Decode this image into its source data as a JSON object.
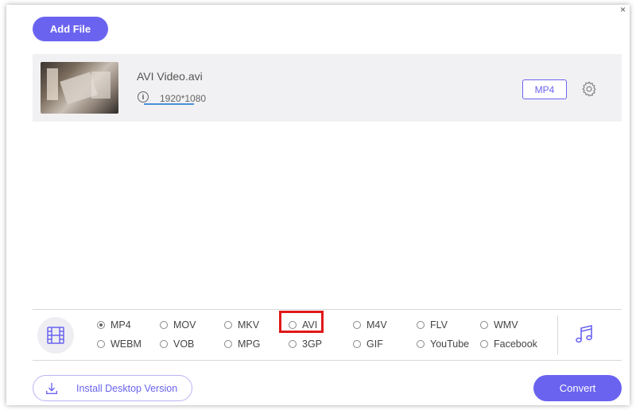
{
  "window": {
    "close_glyph": "×"
  },
  "toolbar": {
    "add_file_label": "Add File"
  },
  "file": {
    "name": "AVI Video.avi",
    "resolution": "1920*1080",
    "info_glyph": "i",
    "output_format": "MP4"
  },
  "formats": {
    "video_category_icon": "film-icon",
    "audio_category_icon": "music-note-icon",
    "row1": [
      "MP4",
      "MOV",
      "MKV",
      "AVI",
      "M4V",
      "FLV",
      "WMV"
    ],
    "row2": [
      "WEBM",
      "VOB",
      "MPG",
      "3GP",
      "GIF",
      "YouTube",
      "Facebook"
    ],
    "selected": "MP4",
    "highlighted": "AVI"
  },
  "footer": {
    "install_label": "Install Desktop Version",
    "convert_label": "Convert"
  },
  "colors": {
    "accent": "#6a63f0",
    "highlight_box": "#e01818",
    "progress_line": "#4a90d9"
  }
}
